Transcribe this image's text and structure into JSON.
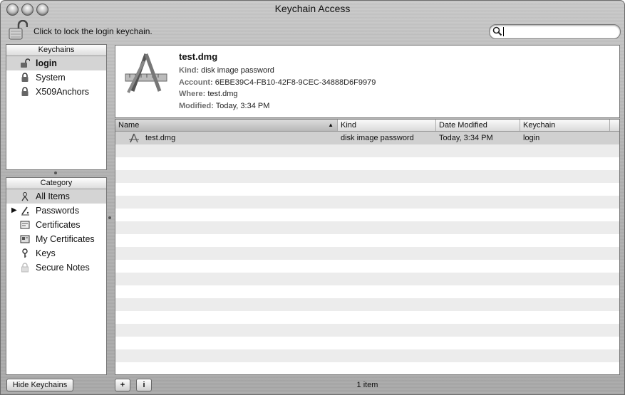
{
  "window": {
    "title": "Keychain Access"
  },
  "toolbar": {
    "lock_label": "Click to lock the login keychain."
  },
  "search": {
    "value": "",
    "placeholder": ""
  },
  "keychains": {
    "header": "Keychains",
    "items": [
      {
        "label": "login",
        "icon": "unlocked-padlock-icon",
        "selected": true
      },
      {
        "label": "System",
        "icon": "padlock-icon"
      },
      {
        "label": "X509Anchors",
        "icon": "padlock-icon"
      }
    ]
  },
  "category": {
    "header": "Category",
    "items": [
      {
        "label": "All Items",
        "icon": "all-items-icon",
        "selected": true
      },
      {
        "label": "Passwords",
        "icon": "key-pencil-icon",
        "expandable": true
      },
      {
        "label": "Certificates",
        "icon": "certificate-icon"
      },
      {
        "label": "My Certificates",
        "icon": "my-certificate-icon"
      },
      {
        "label": "Keys",
        "icon": "key-icon"
      },
      {
        "label": "Secure Notes",
        "icon": "note-icon"
      }
    ]
  },
  "detail": {
    "name": "test.dmg",
    "kind_key": "Kind:",
    "kind": "disk image password",
    "account_key": "Account:",
    "account": "6EBE39C4-FB10-42F8-9CEC-34888D6F9979",
    "where_key": "Where:",
    "where": "test.dmg",
    "modified_key": "Modified:",
    "modified": "Today, 3:34 PM"
  },
  "table": {
    "columns": [
      "Name",
      "Kind",
      "Date Modified",
      "Keychain"
    ],
    "sort_column": "Name",
    "rows": [
      {
        "name": "test.dmg",
        "kind": "disk image password",
        "date": "Today, 3:34 PM",
        "keychain": "login"
      }
    ]
  },
  "footer": {
    "hide_keychains": "Hide Keychains",
    "add": "+",
    "info": "i",
    "status": "1 item"
  }
}
